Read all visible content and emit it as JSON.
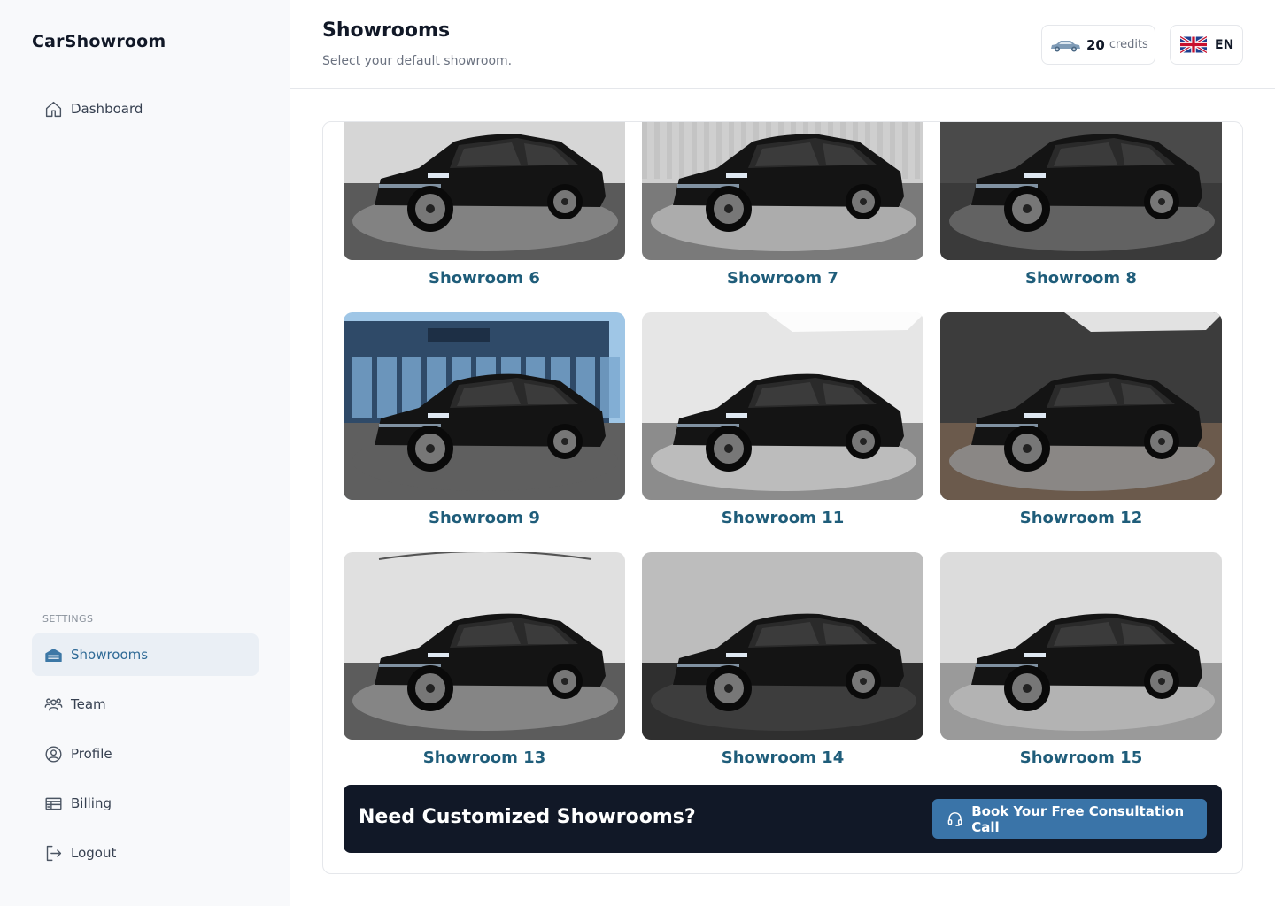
{
  "sidebar": {
    "brand": "CarShowroom",
    "nav": [
      {
        "label": "Dashboard",
        "icon": "home-icon"
      }
    ],
    "settings_label": "SETTINGS",
    "settings": [
      {
        "label": "Showrooms",
        "icon": "garage-icon",
        "active": true
      },
      {
        "label": "Team",
        "icon": "team-icon"
      },
      {
        "label": "Profile",
        "icon": "user-circle-icon"
      },
      {
        "label": "Billing",
        "icon": "billing-icon"
      },
      {
        "label": "Logout",
        "icon": "logout-icon"
      }
    ]
  },
  "header": {
    "title": "Showrooms",
    "subtitle": "Select your default showroom.",
    "credits_value": "20",
    "credits_label": "credits",
    "language": "EN"
  },
  "showrooms": [
    {
      "label": "Showroom 6",
      "bg": "turntable-dark"
    },
    {
      "label": "Showroom 7",
      "bg": "curtain-studio"
    },
    {
      "label": "Showroom 8",
      "bg": "dark-tiles"
    },
    {
      "label": "Showroom 9",
      "bg": "dealership-exterior"
    },
    {
      "label": "Showroom 11",
      "bg": "white-room"
    },
    {
      "label": "Showroom 12",
      "bg": "dark-room"
    },
    {
      "label": "Showroom 13",
      "bg": "light-turntable"
    },
    {
      "label": "Showroom 14",
      "bg": "grey-studio"
    },
    {
      "label": "Showroom 15",
      "bg": "light-grey-studio"
    }
  ],
  "cta": {
    "title": "Need Customized Showrooms?",
    "button": "Book Your Free Consultation Call"
  },
  "colors": {
    "accent": "#3a74a8",
    "label": "#1f5d7a",
    "cta_bg": "#111827",
    "active_nav_bg": "#eaeff5"
  }
}
